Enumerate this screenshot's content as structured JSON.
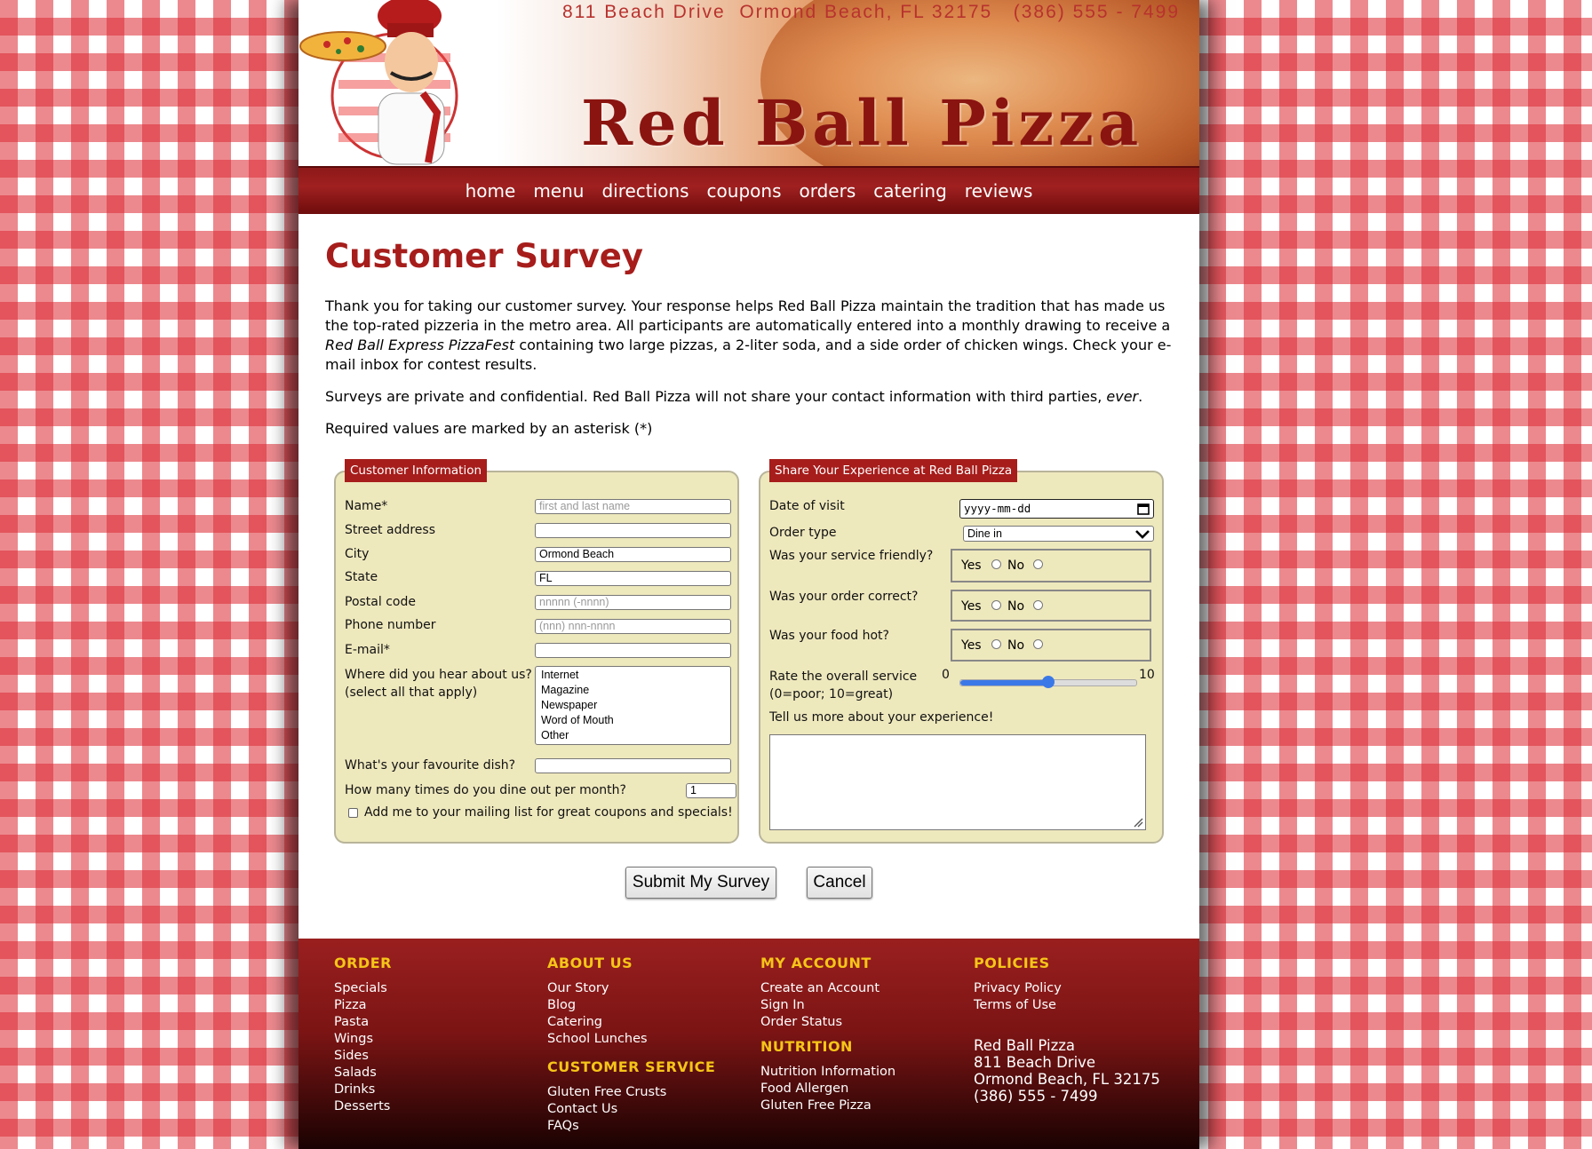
{
  "header": {
    "address": "811 Beach Drive  Ormond Beach, FL 32175   (386) 555 - 7499",
    "brand": "Red Ball Pizza"
  },
  "nav": [
    "home",
    "menu",
    "directions",
    "coupons",
    "orders",
    "catering",
    "reviews"
  ],
  "page": {
    "title": "Customer Survey",
    "intro_before": "Thank you for taking our customer survey. Your response helps Red Ball Pizza maintain the tradition that has made us the top-rated pizzeria in the metro area. All participants are automatically entered into a monthly drawing to receive a ",
    "intro_em": "Red Ball Express PizzaFest",
    "intro_after": " containing two large pizzas, a 2-liter soda, and a side order of chicken wings. Check your e-mail inbox for contest results.",
    "privacy_before": "Surveys are private and confidential. Red Ball Pizza will not share your contact information with third parties, ",
    "privacy_em": "ever",
    "privacy_after": ".",
    "required_note": "Required values are marked by an asterisk (*)"
  },
  "customer": {
    "legend": "Customer Information",
    "name_label": "Name*",
    "name_placeholder": "first and last name",
    "street_label": "Street address",
    "city_label": "City",
    "city_value": "Ormond Beach",
    "state_label": "State",
    "state_value": "FL",
    "postal_label": "Postal code",
    "postal_placeholder": "nnnnn (-nnnn)",
    "phone_label": "Phone number",
    "phone_placeholder": "(nnn) nnn-nnnn",
    "email_label": "E-mail*",
    "hear_label": "Where did you hear about us?",
    "hear_sub": "(select all that apply)",
    "hear_options": [
      "Internet",
      "Magazine",
      "Newspaper",
      "Word of Mouth",
      "Other"
    ],
    "dish_label": "What's your favourite dish?",
    "dine_label": "How many times do you dine out per month?",
    "dine_value": "1",
    "mailing_label": "Add me to your mailing list for great coupons and specials!"
  },
  "experience": {
    "legend": "Share Your Experience at Red Ball Pizza",
    "date_label": "Date of visit",
    "date_placeholder": "yyyy-mm-dd",
    "order_label": "Order type",
    "order_value": "Dine in",
    "friendly_label": "Was your service friendly?",
    "correct_label": "Was your order correct?",
    "hot_label": "Was your food hot?",
    "yes": "Yes",
    "no": "No",
    "rate_label": "Rate the overall service",
    "rate_sub": "(0=poor; 10=great)",
    "rate_min": "0",
    "rate_max": "10",
    "rate_value": 5,
    "more_label": "Tell us more about your experience!"
  },
  "buttons": {
    "submit": "Submit My Survey",
    "cancel": "Cancel"
  },
  "footer": {
    "order": {
      "heading": "ORDER",
      "links": [
        "Specials",
        "Pizza",
        "Pasta",
        "Wings",
        "Sides",
        "Salads",
        "Drinks",
        "Desserts"
      ]
    },
    "about": {
      "heading": "ABOUT US",
      "links": [
        "Our Story",
        "Blog",
        "Catering",
        "School Lunches"
      ]
    },
    "service": {
      "heading": "CUSTOMER SERVICE",
      "links": [
        "Gluten Free Crusts",
        "Contact Us",
        "FAQs"
      ]
    },
    "account": {
      "heading": "MY ACCOUNT",
      "links": [
        "Create an Account",
        "Sign In",
        "Order Status"
      ]
    },
    "nutrition": {
      "heading": "NUTRITION",
      "links": [
        "Nutrition Information",
        "Food Allergen",
        "Gluten Free Pizza"
      ]
    },
    "policies": {
      "heading": "POLICIES",
      "links": [
        "Privacy Policy",
        "Terms of Use"
      ]
    },
    "contact": [
      "Red Ball Pizza",
      "811 Beach Drive",
      "Ormond Beach, FL 32175",
      "(386) 555 - 7499"
    ]
  },
  "colors": {
    "brand_red": "#a61d1b",
    "form_bg": "#eee8bd",
    "footer_heading": "#f5c518"
  }
}
